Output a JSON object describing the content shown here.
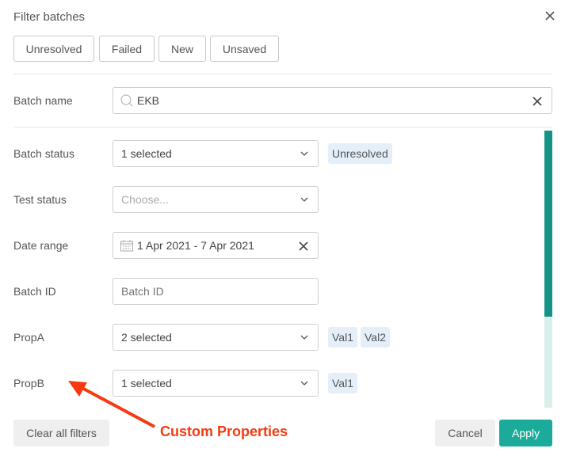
{
  "dialog": {
    "title": "Filter batches",
    "close_icon": "close-icon"
  },
  "quick_filters": [
    {
      "label": "Unresolved"
    },
    {
      "label": "Failed"
    },
    {
      "label": "New"
    },
    {
      "label": "Unsaved"
    }
  ],
  "batch_name": {
    "label": "Batch name",
    "value": "EKB",
    "icon": "search-icon",
    "clear_icon": "close-icon"
  },
  "batch_status": {
    "label": "Batch status",
    "value": "1 selected",
    "tags": [
      "Unresolved"
    ]
  },
  "test_status": {
    "label": "Test status",
    "placeholder": "Choose..."
  },
  "date_range": {
    "label": "Date range",
    "value": "1 Apr 2021 - 7 Apr 2021",
    "icon": "calendar-icon",
    "clear_icon": "close-icon"
  },
  "batch_id": {
    "label": "Batch ID",
    "placeholder": "Batch ID"
  },
  "prop_a": {
    "label": "PropA",
    "value": "2 selected",
    "tags": [
      "Val1",
      "Val2"
    ]
  },
  "prop_b": {
    "label": "PropB",
    "value": "1 selected",
    "tags": [
      "Val1"
    ]
  },
  "footer": {
    "clear_all_label": "Clear all filters",
    "cancel_label": "Cancel",
    "apply_label": "Apply"
  },
  "annotation": {
    "text": "Custom Properties"
  },
  "colors": {
    "accent": "#1aab9b",
    "scroll_thumb": "#139487",
    "tag_bg": "#e4effa",
    "annotation": "#f53a12"
  }
}
